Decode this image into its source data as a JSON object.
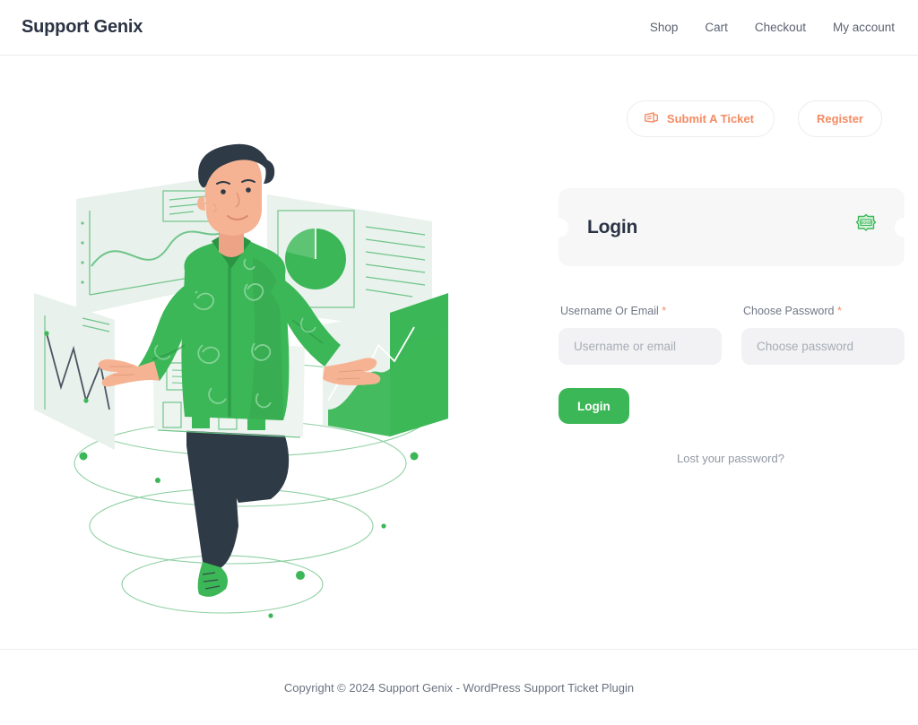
{
  "header": {
    "brand": "Support Genix",
    "nav": [
      {
        "label": "Shop"
      },
      {
        "label": "Cart"
      },
      {
        "label": "Checkout"
      },
      {
        "label": "My account"
      }
    ]
  },
  "actions": {
    "submit_ticket": "Submit A Ticket",
    "register": "Register",
    "submit_ticket_icon": "ticket-icon"
  },
  "login_panel": {
    "title": "Login",
    "badge_icon": "ticket-badge-icon",
    "badge_text": "TICKET",
    "fields": [
      {
        "label": "Username Or Email",
        "required_mark": "*",
        "placeholder": "Username or email",
        "value": "",
        "type": "text"
      },
      {
        "label": "Choose Password",
        "required_mark": "*",
        "placeholder": "Choose password",
        "value": "",
        "type": "password"
      }
    ],
    "submit_label": "Login",
    "lost_password": "Lost your password?"
  },
  "illustration": {
    "name": "analytics-dashboard-man-illustration",
    "alt": "Man in green shirt surrounded by floating chart panels"
  },
  "footer": {
    "copyright": "Copyright © 2024 Support Genix - WordPress Support Ticket Plugin"
  },
  "colors": {
    "accent_green": "#3cb757",
    "accent_orange": "#f58b63",
    "text_dark": "#2b3445",
    "text_muted": "#9298a4",
    "panel_bg": "#f7f7f8",
    "input_bg": "#f2f2f4"
  }
}
